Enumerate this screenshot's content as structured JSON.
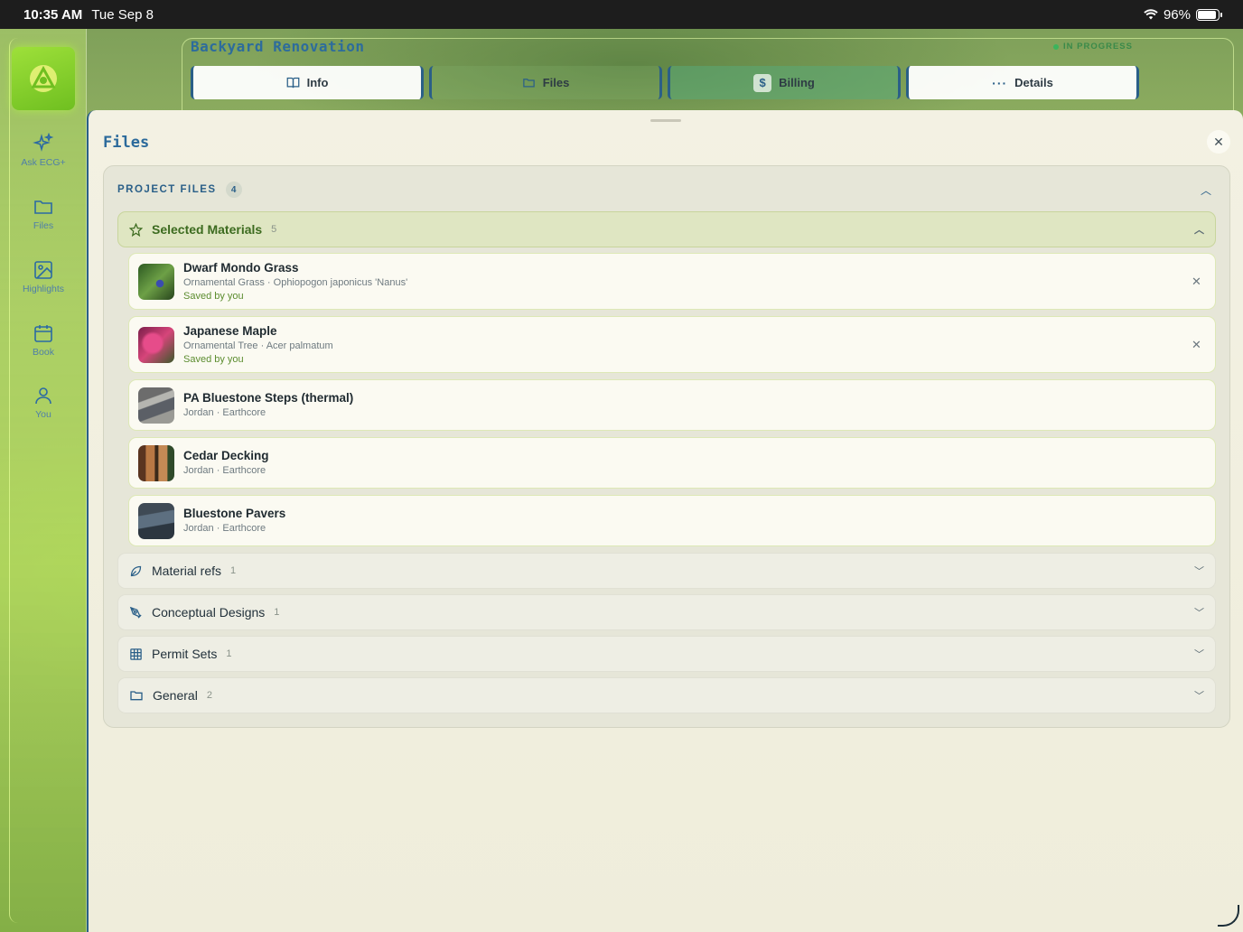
{
  "status_bar": {
    "time": "10:35 AM",
    "date": "Tue Sep 8",
    "battery": "96%"
  },
  "sidebar": {
    "items": [
      {
        "label": "Ask ECG+",
        "icon": "sparkles-icon"
      },
      {
        "label": "Files",
        "icon": "folder-icon"
      },
      {
        "label": "Highlights",
        "icon": "image-icon"
      },
      {
        "label": "Book",
        "icon": "calendar-icon"
      },
      {
        "label": "You",
        "icon": "person-icon"
      }
    ]
  },
  "project": {
    "title": "Backyard Renovation",
    "status": "IN PROGRESS"
  },
  "tabs": [
    {
      "label": "Info",
      "icon": "book-icon"
    },
    {
      "label": "Files",
      "icon": "folder-icon"
    },
    {
      "label": "Billing",
      "icon": "dollar-icon"
    },
    {
      "label": "Details",
      "icon": "ellipsis-icon"
    }
  ],
  "sheet": {
    "title": "Files",
    "section_label": "PROJECT FILES",
    "section_count": "4",
    "selected_group": {
      "label": "Selected Materials",
      "count": "5",
      "items": [
        {
          "name": "Dwarf Mondo Grass",
          "sub": "Ornamental Grass · Ophiopogon japonicus 'Nanus'",
          "saved": "Saved by you"
        },
        {
          "name": "Japanese Maple",
          "sub": "Ornamental Tree · Acer palmatum",
          "saved": "Saved by you"
        },
        {
          "name": "PA Bluestone Steps (thermal)",
          "sub": "Jordan · Earthcore"
        },
        {
          "name": "Cedar Decking",
          "sub": "Jordan · Earthcore"
        },
        {
          "name": "Bluestone Pavers",
          "sub": "Jordan · Earthcore"
        }
      ]
    },
    "groups": [
      {
        "label": "Material refs",
        "count": "1",
        "icon": "leaf-icon"
      },
      {
        "label": "Conceptual Designs",
        "count": "1",
        "icon": "pen-tool-icon"
      },
      {
        "label": "Permit Sets",
        "count": "1",
        "icon": "table-icon"
      },
      {
        "label": "General",
        "count": "2",
        "icon": "folder-icon"
      }
    ]
  }
}
